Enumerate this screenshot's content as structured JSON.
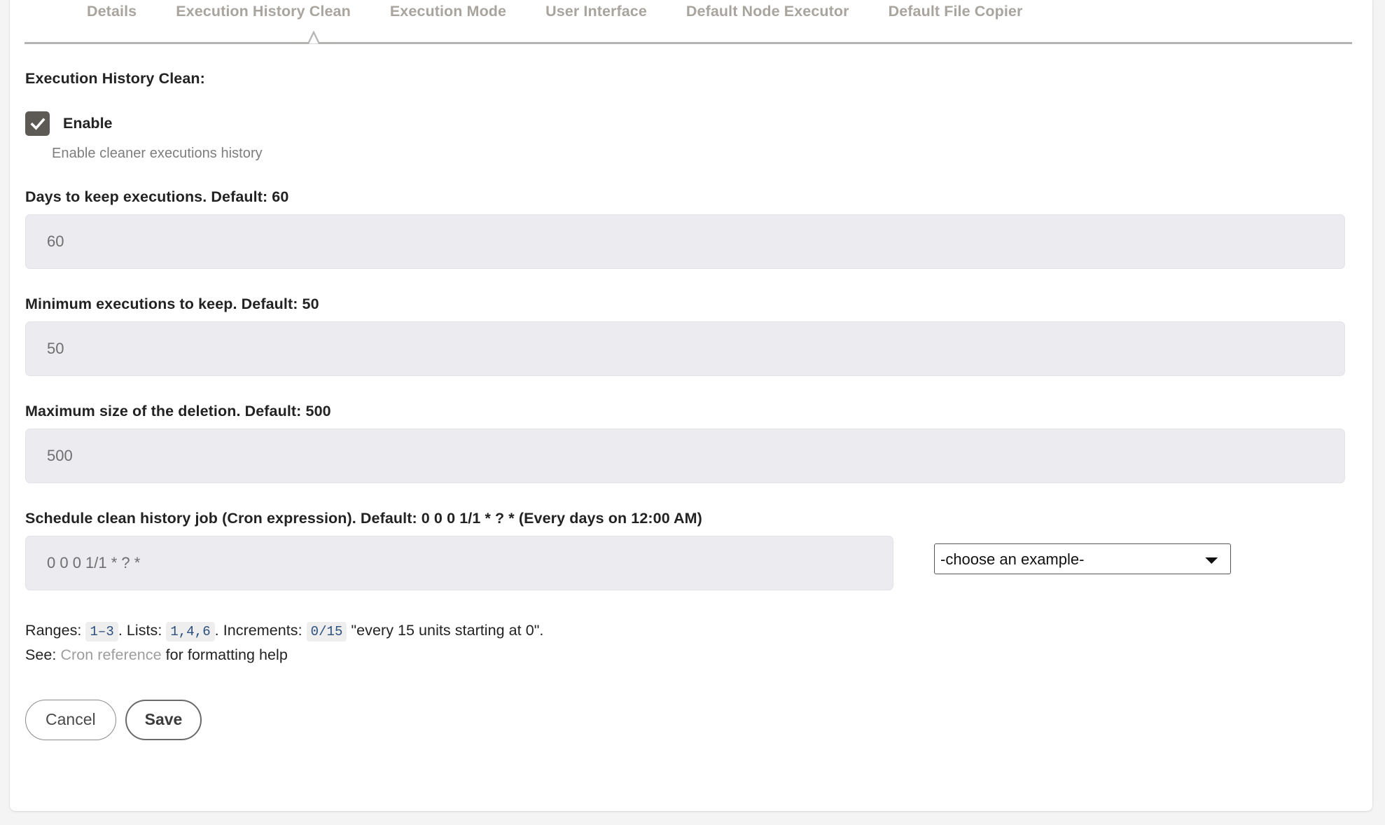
{
  "tabs": [
    {
      "label": "Details",
      "active": false
    },
    {
      "label": "Execution History Clean",
      "active": true
    },
    {
      "label": "Execution Mode",
      "active": false
    },
    {
      "label": "User Interface",
      "active": false
    },
    {
      "label": "Default Node Executor",
      "active": false
    },
    {
      "label": "Default File Copier",
      "active": false
    }
  ],
  "section": {
    "title": "Execution History Clean:"
  },
  "enable": {
    "label": "Enable",
    "checked": true,
    "help": "Enable cleaner executions history"
  },
  "fields": {
    "days": {
      "label": "Days to keep executions. Default: 60",
      "value": "",
      "placeholder": "60"
    },
    "minimum": {
      "label": "Minimum executions to keep. Default: 50",
      "value": "",
      "placeholder": "50"
    },
    "maximum": {
      "label": "Maximum size of the deletion. Default: 500",
      "value": "",
      "placeholder": "500"
    },
    "cron": {
      "label": "Schedule clean history job (Cron expression). Default: 0 0 0 1/1 * ? * (Every days on 12:00 AM)",
      "value": "",
      "placeholder": "0 0 0 1/1 * ? *"
    }
  },
  "cron_examples": {
    "selected": "-choose an example-",
    "options": [
      "-choose an example-"
    ]
  },
  "hints": {
    "ranges_label": "Ranges:",
    "ranges_code": "1–3",
    "ranges_dot": ".",
    "lists_label": "Lists:",
    "lists_code": "1,4,6",
    "lists_dot": ".",
    "increments_label": "Increments:",
    "increments_code": "0/15",
    "increments_text": "\"every 15 units starting at 0\".",
    "see_label": "See:",
    "link_text": "Cron reference",
    "see_suffix": "for formatting help"
  },
  "buttons": {
    "cancel": "Cancel",
    "save": "Save"
  },
  "colors": {
    "page_bg": "#f4f4f4",
    "card_bg": "#ffffff",
    "tab_text": "#a9a49e",
    "tab_rule": "#b5b3b1",
    "checkbox_fill": "#5d5a55",
    "input_bg": "#ebebf0",
    "input_text": "#6f6f6f",
    "code_text": "#2a4f7c",
    "code_bg": "#eeeeee",
    "link": "#9d9d9d"
  }
}
